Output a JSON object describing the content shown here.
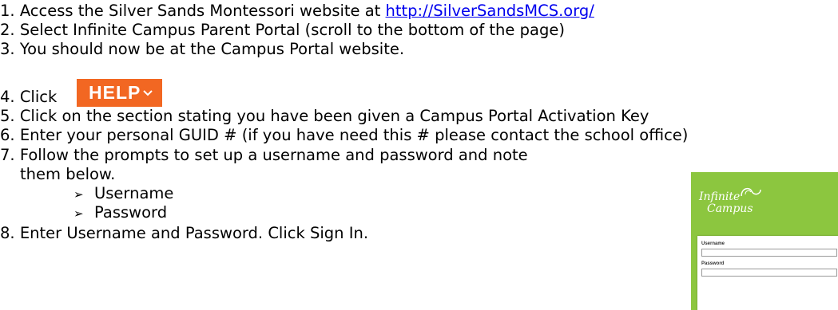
{
  "steps": [
    {
      "num": "1.",
      "text": "Access the Silver Sands Montessori website at ",
      "link": "http://SilverSandsMCS.org/"
    },
    {
      "num": "2.",
      "text": "Select Infinite Campus Parent Portal (scroll to the bottom of the page)"
    },
    {
      "num": "3.",
      "text": "You should now be at the Campus Portal website."
    },
    {
      "num": "4.",
      "text": "Click"
    },
    {
      "num": "5.",
      "text": "Click on the section stating you have been given a Campus Portal Activation Key"
    },
    {
      "num": "6.",
      "text": "Enter your personal GUID # (if you have need this # please contact the school office)"
    },
    {
      "num": "7.",
      "text": "Follow the prompts to set up a username and password and note",
      "text2": "them below."
    },
    {
      "num": "8.",
      "text": "Enter Username and Password. Click Sign In."
    }
  ],
  "credentials": [
    {
      "bullet": "➢",
      "label": "Username"
    },
    {
      "bullet": "➢",
      "label": "Password"
    }
  ],
  "help_button": {
    "label": "HELP",
    "color": "#f26722"
  },
  "portal_thumbnail": {
    "logo_line1": "Infinite",
    "logo_line2": "Campus",
    "username_label": "Username",
    "password_label": "Password",
    "brand_color": "#8cc63f"
  }
}
